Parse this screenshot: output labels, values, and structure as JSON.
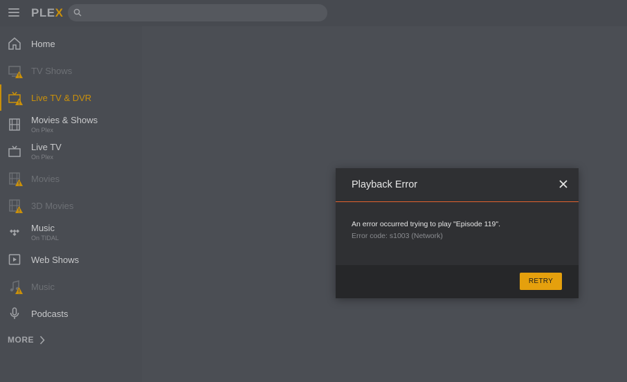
{
  "app": {
    "logo_text": "PLEX",
    "logo_main": "PLE",
    "logo_accent": "X"
  },
  "search": {
    "placeholder": ""
  },
  "sidebar": {
    "items": [
      {
        "label": "Home",
        "sub": "",
        "icon": "home-icon",
        "state": "normal"
      },
      {
        "label": "TV Shows",
        "sub": "",
        "icon": "tv-icon",
        "state": "dim-warning"
      },
      {
        "label": "Live TV & DVR",
        "sub": "",
        "icon": "live-tv-icon",
        "state": "active-warning"
      },
      {
        "label": "Movies & Shows",
        "sub": "On Plex",
        "icon": "film-icon",
        "state": "normal"
      },
      {
        "label": "Live TV",
        "sub": "On Plex",
        "icon": "tv-icon",
        "state": "normal"
      },
      {
        "label": "Movies",
        "sub": "",
        "icon": "film-icon",
        "state": "dim-warning"
      },
      {
        "label": "3D Movies",
        "sub": "",
        "icon": "film-icon",
        "state": "dim-warning"
      },
      {
        "label": "Music",
        "sub": "On TIDAL",
        "icon": "tidal-icon",
        "state": "normal"
      },
      {
        "label": "Web Shows",
        "sub": "",
        "icon": "play-icon",
        "state": "normal"
      },
      {
        "label": "Music",
        "sub": "",
        "icon": "music-note-icon",
        "state": "dim-warning"
      },
      {
        "label": "Podcasts",
        "sub": "",
        "icon": "microphone-icon",
        "state": "normal"
      }
    ],
    "more_label": "MORE"
  },
  "dialog": {
    "title": "Playback Error",
    "message": "An error occurred trying to play \"Episode 119\".",
    "error_code": "Error code: s1003 (Network)",
    "retry_label": "RETRY"
  },
  "colors": {
    "accent": "#e5a00d",
    "divider": "#e5632e",
    "warning": "#c9900b"
  }
}
